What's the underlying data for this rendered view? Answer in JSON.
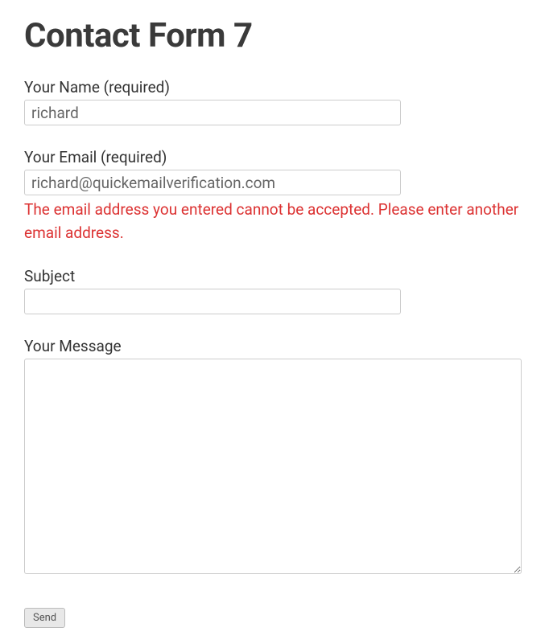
{
  "page": {
    "title": "Contact Form 7"
  },
  "form": {
    "name": {
      "label": "Your Name (required)",
      "value": "richard"
    },
    "email": {
      "label": "Your Email (required)",
      "value": "richard@quickemailverification.com",
      "error": "The email address you entered cannot be accepted. Please enter another email address."
    },
    "subject": {
      "label": "Subject",
      "value": ""
    },
    "message": {
      "label": "Your Message",
      "value": ""
    },
    "submit": {
      "label": "Send"
    }
  }
}
